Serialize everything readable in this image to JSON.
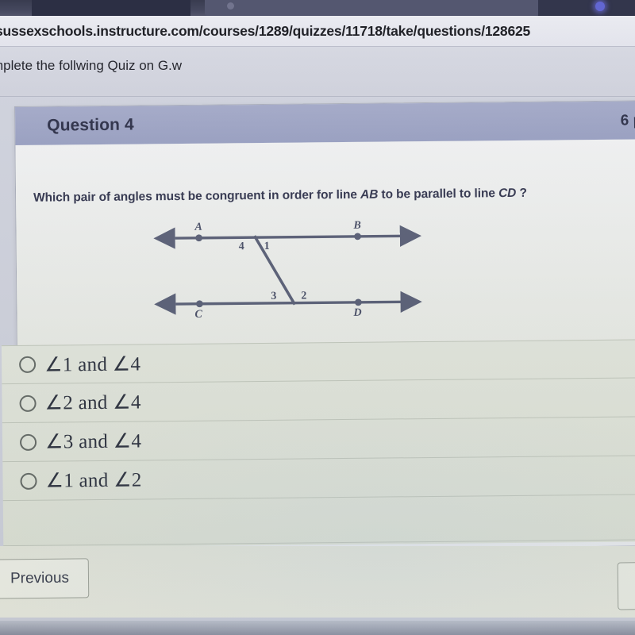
{
  "browser": {
    "url": "sussexschools.instructure.com/courses/1289/quizzes/11718/take/questions/128625"
  },
  "page": {
    "instructions": "mplete the follwing Quiz on G.w"
  },
  "question": {
    "title": "Question 4",
    "points": "6 p",
    "prompt_part1": "Which pair of angles must be congruent in order for line ",
    "prompt_line_ab": "AB",
    "prompt_part2": " to be parallel to line ",
    "prompt_line_cd": "CD",
    "prompt_part3": " ?"
  },
  "diagram": {
    "point_a": "A",
    "point_b": "B",
    "point_c": "C",
    "point_d": "D",
    "angle_4": "4",
    "angle_1": "1",
    "angle_3": "3",
    "angle_2": "2",
    "line_color": "#5a6077"
  },
  "answers": [
    {
      "label": "∠1 and ∠4",
      "selected": false
    },
    {
      "label": "∠2 and ∠4",
      "selected": false
    },
    {
      "label": "∠3 and ∠4",
      "selected": false
    },
    {
      "label": "∠1 and ∠2",
      "selected": false
    }
  ],
  "footer": {
    "previous_label": "Previous"
  },
  "colors": {
    "header_band": "#9aa2c4",
    "answer_bg": "#dde2d8",
    "text_dark": "#2f3441",
    "prompt_blue": "#33364f"
  }
}
